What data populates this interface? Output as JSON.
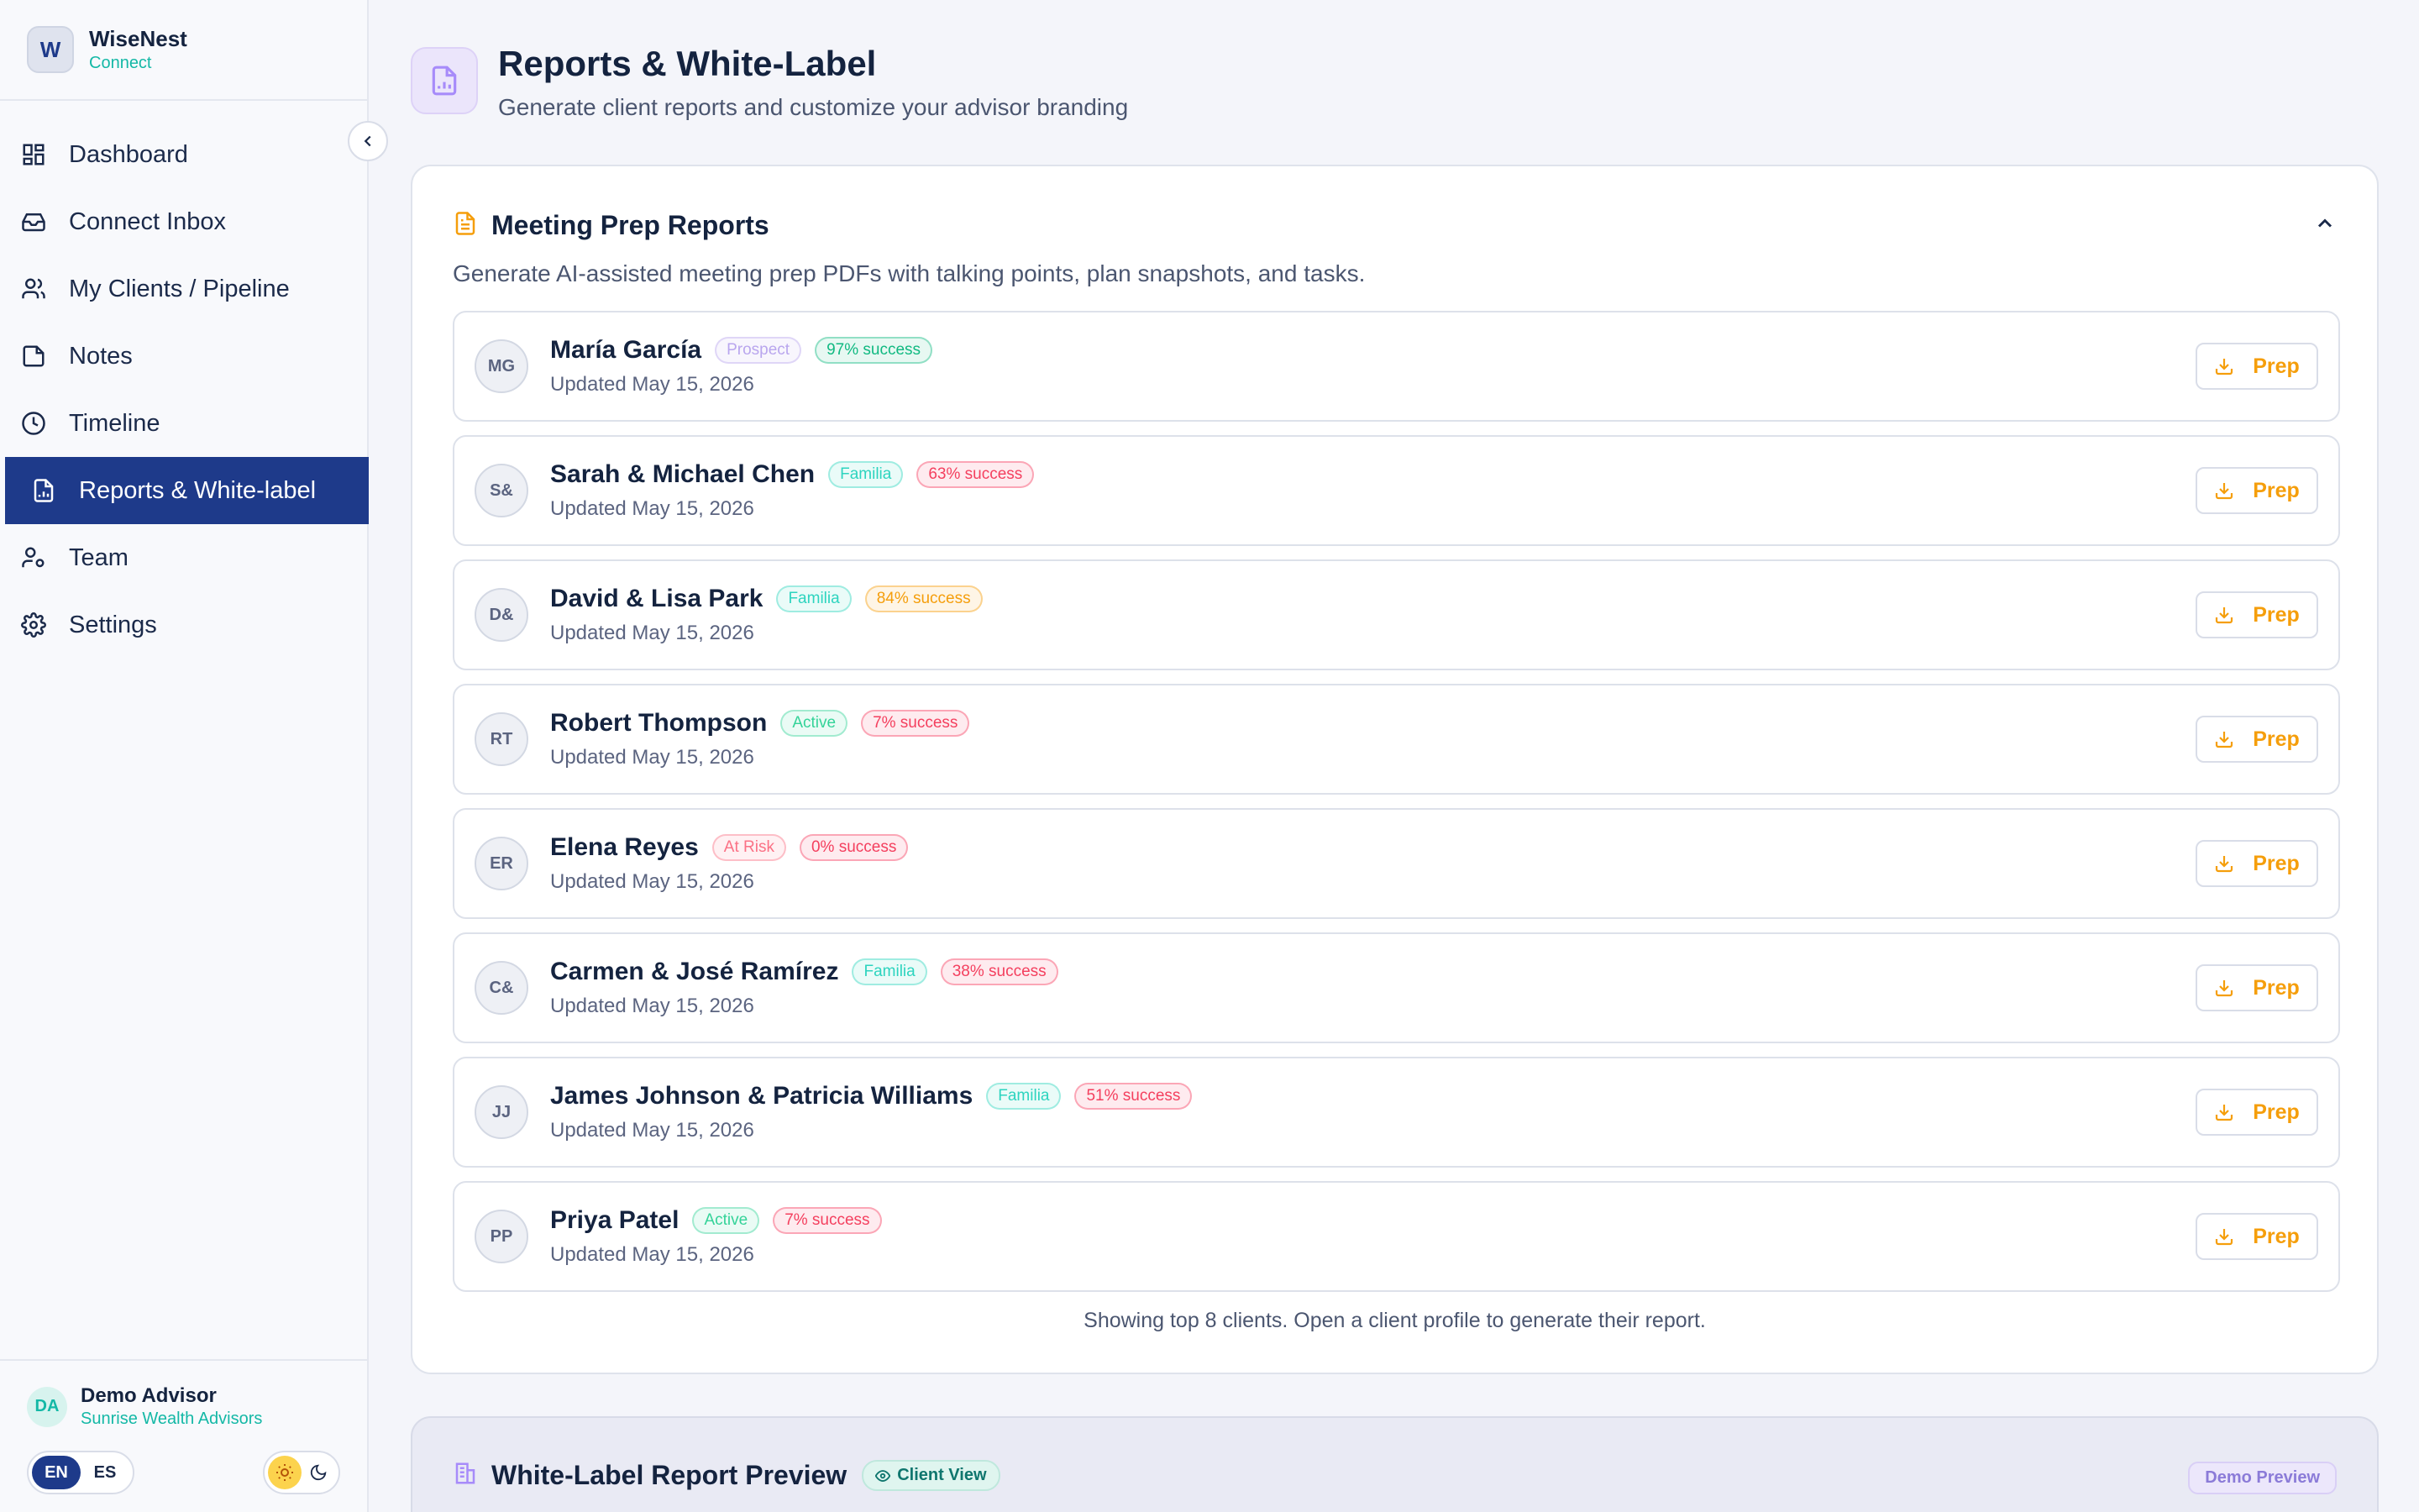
{
  "brand": {
    "initial": "W",
    "name": "WiseNest",
    "sub": "Connect"
  },
  "nav": [
    {
      "label": "Dashboard",
      "icon": "dashboard-icon",
      "active": false
    },
    {
      "label": "Connect Inbox",
      "icon": "inbox-icon",
      "active": false
    },
    {
      "label": "My Clients / Pipeline",
      "icon": "users-icon",
      "active": false
    },
    {
      "label": "Notes",
      "icon": "note-icon",
      "active": false
    },
    {
      "label": "Timeline",
      "icon": "clock-icon",
      "active": false
    },
    {
      "label": "Reports & White-label",
      "icon": "report-icon",
      "active": true
    },
    {
      "label": "Team",
      "icon": "team-icon",
      "active": false
    },
    {
      "label": "Settings",
      "icon": "gear-icon",
      "active": false
    }
  ],
  "user": {
    "initials": "DA",
    "name": "Demo Advisor",
    "org": "Sunrise Wealth Advisors"
  },
  "lang": {
    "en": "EN",
    "es": "ES",
    "selected": "EN"
  },
  "theme": {
    "selected": "light"
  },
  "header": {
    "title": "Reports & White-Label",
    "subtitle": "Generate client reports and customize your advisor branding"
  },
  "meeting_prep": {
    "title": "Meeting Prep Reports",
    "description": "Generate AI-assisted meeting prep PDFs with talking points, plan snapshots, and tasks.",
    "button_label": "Prep",
    "footer": "Showing top 8 clients. Open a client profile to generate their report.",
    "clients": [
      {
        "initials": "MG",
        "name": "María García",
        "status": "Prospect",
        "status_color": "#b9a6ee",
        "success": "97% success",
        "success_color": "#10b981",
        "updated": "Updated May 15, 2026"
      },
      {
        "initials": "S&",
        "name": "Sarah & Michael Chen",
        "status": "Familia",
        "status_color": "#2dd4bf",
        "success": "63% success",
        "success_color": "#f43f5e",
        "updated": "Updated May 15, 2026"
      },
      {
        "initials": "D&",
        "name": "David & Lisa Park",
        "status": "Familia",
        "status_color": "#2dd4bf",
        "success": "84% success",
        "success_color": "#f59e0b",
        "updated": "Updated May 15, 2026"
      },
      {
        "initials": "RT",
        "name": "Robert Thompson",
        "status": "Active",
        "status_color": "#34d399",
        "success": "7% success",
        "success_color": "#f43f5e",
        "updated": "Updated May 15, 2026"
      },
      {
        "initials": "ER",
        "name": "Elena Reyes",
        "status": "At Risk",
        "status_color": "#fb7185",
        "success": "0% success",
        "success_color": "#f43f5e",
        "updated": "Updated May 15, 2026"
      },
      {
        "initials": "C&",
        "name": "Carmen & José Ramírez",
        "status": "Familia",
        "status_color": "#2dd4bf",
        "success": "38% success",
        "success_color": "#f43f5e",
        "updated": "Updated May 15, 2026"
      },
      {
        "initials": "JJ",
        "name": "James Johnson & Patricia Williams",
        "status": "Familia",
        "status_color": "#2dd4bf",
        "success": "51% success",
        "success_color": "#f43f5e",
        "updated": "Updated May 15, 2026"
      },
      {
        "initials": "PP",
        "name": "Priya Patel",
        "status": "Active",
        "status_color": "#34d399",
        "success": "7% success",
        "success_color": "#f43f5e",
        "updated": "Updated May 15, 2026"
      }
    ]
  },
  "white_label": {
    "title": "White-Label Report Preview",
    "client_view": "Client View",
    "demo_badge": "Demo Preview"
  },
  "colors": {
    "primary": "#1e3a8a",
    "accent": "#14b8a6",
    "warning": "#f59e0b",
    "purple": "#a78bfa"
  }
}
